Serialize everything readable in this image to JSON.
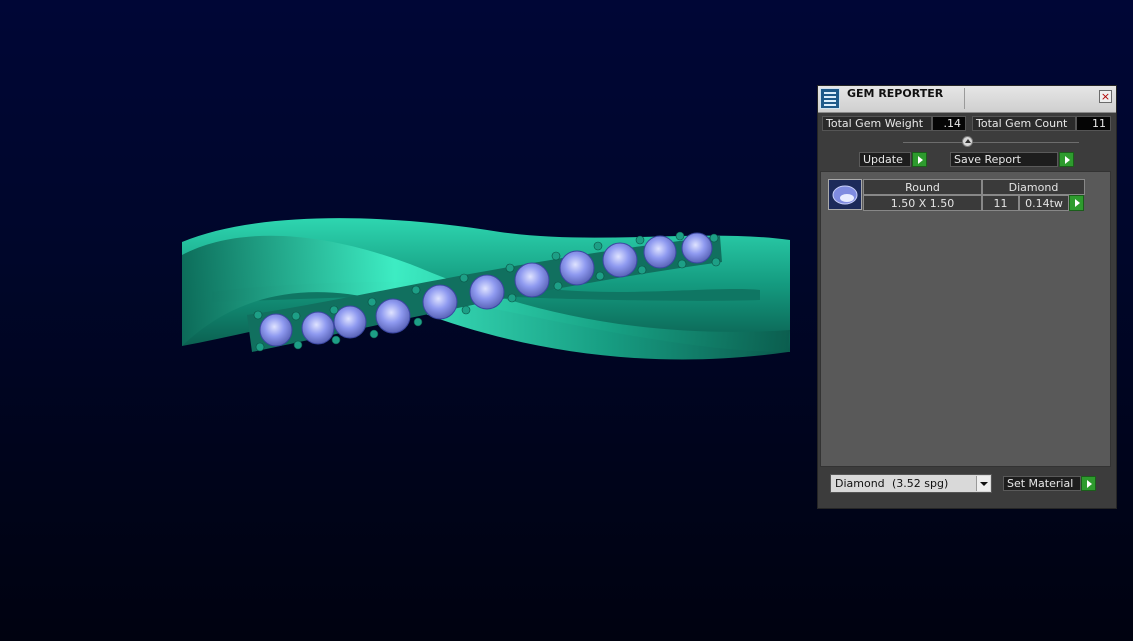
{
  "panel": {
    "title": "GEM REPORTER",
    "close_glyph": "×",
    "total_weight_label": "Total Gem Weight",
    "total_weight_value": ".14",
    "total_count_label": "Total Gem Count",
    "total_count_value": "11",
    "update_label": "Update",
    "save_report_label": "Save Report",
    "gem_row": {
      "shape": "Round",
      "material": "Diamond",
      "size": "1.50 X 1.50",
      "count": "11",
      "weight": "0.14tw"
    },
    "material_select": {
      "name": "Diamond",
      "density": "(3.52 spg)"
    },
    "set_material_label": "Set Material"
  },
  "colors": {
    "ring": "#1fa78b",
    "gem": "#8f9af0",
    "accent_go": "#2e9b2e",
    "background": "#000636"
  },
  "icons": {
    "app": "gem-reporter-icon",
    "close": "close-icon",
    "go": "play-arrow-icon",
    "collapse": "collapse-icon",
    "dropdown": "chevron-down-icon"
  }
}
